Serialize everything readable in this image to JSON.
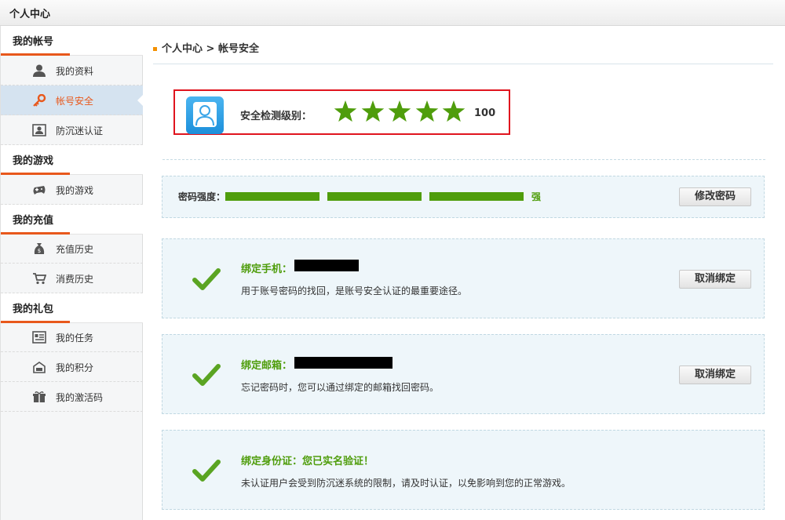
{
  "window": {
    "title": "个人中心"
  },
  "sidebar": {
    "sections": [
      {
        "title": "我的帐号",
        "items": [
          {
            "label": "我的资料",
            "icon": "user-icon"
          },
          {
            "label": "帐号安全",
            "icon": "key-icon",
            "active": true
          },
          {
            "label": "防沉迷认证",
            "icon": "id-card-icon"
          }
        ]
      },
      {
        "title": "我的游戏",
        "items": [
          {
            "label": "我的游戏",
            "icon": "gamepad-icon"
          }
        ]
      },
      {
        "title": "我的充值",
        "items": [
          {
            "label": "充值历史",
            "icon": "money-bag-icon"
          },
          {
            "label": "消费历史",
            "icon": "cart-icon"
          }
        ]
      },
      {
        "title": "我的礼包",
        "items": [
          {
            "label": "我的任务",
            "icon": "task-list-icon"
          },
          {
            "label": "我的积分",
            "icon": "points-icon"
          },
          {
            "label": "我的激活码",
            "icon": "gift-code-icon"
          }
        ]
      }
    ]
  },
  "breadcrumb": {
    "text": "个人中心 > 帐号安全"
  },
  "security_level": {
    "label": "安全检测级别：",
    "stars": 5,
    "score": "100",
    "star_color": "#4f9d0c"
  },
  "password": {
    "label": "密码强度：",
    "strength": "强",
    "strength_level": 3,
    "button": "修改密码"
  },
  "phone": {
    "title": "绑定手机：",
    "desc": "用于账号密码的找回，是账号安全认证的最重要途径。",
    "button": "取消绑定"
  },
  "email": {
    "title": "绑定邮箱：",
    "desc": "忘记密码时，您可以通过绑定的邮箱找回密码。",
    "button": "取消绑定"
  },
  "identity": {
    "title": "绑定身份证：您已实名验证！",
    "desc": "未认证用户会受到防沉迷系统的限制，请及时认证，以免影响到您的正常游戏。"
  },
  "colors": {
    "accent": "#e8581c",
    "success": "#4f9d0c",
    "highlight_border": "#e0141e"
  }
}
